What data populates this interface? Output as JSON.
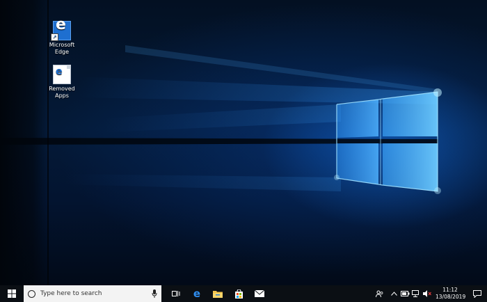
{
  "desktop": {
    "icons": [
      {
        "label": "Microsoft\nEdge",
        "icon": "edge-icon"
      },
      {
        "label": "Removed\nApps",
        "icon": "edge-file-icon"
      }
    ]
  },
  "taskbar": {
    "start_icon": "windows-logo-icon",
    "search_placeholder": "Type here to search",
    "pinned": [
      {
        "name": "Task View",
        "icon": "task-view-icon"
      },
      {
        "name": "Microsoft Edge",
        "icon": "edge-icon"
      },
      {
        "name": "File Explorer",
        "icon": "folder-icon"
      },
      {
        "name": "Microsoft Store",
        "icon": "store-icon"
      },
      {
        "name": "Mail",
        "icon": "mail-icon"
      }
    ],
    "tray": {
      "time": "11:12",
      "date": "13/08/2019"
    }
  },
  "colors": {
    "accent": "#1e6fd0",
    "taskbar": "#0b0f14",
    "glow": "#5fc8ff"
  }
}
